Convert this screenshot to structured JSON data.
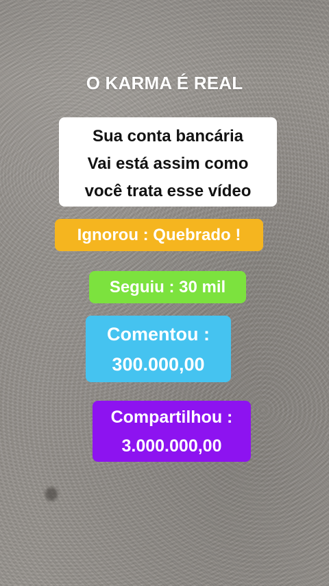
{
  "title": "O KARMA É REAL",
  "message": {
    "line1": "Sua conta bancária",
    "line2": "Vai está assim como",
    "line3": "você trata esse vídeo"
  },
  "outcomes": [
    {
      "label": "Ignorou : Quebrado !",
      "color": "#f5b51f"
    },
    {
      "label": "Seguiu : 30 mil",
      "color": "#7ce23e"
    },
    {
      "label_line1": "Comentou :",
      "label_line2": "300.000,00",
      "color": "#45c3f0"
    },
    {
      "label_line1": "Compartilhou :",
      "label_line2": "3.000.000,00",
      "color": "#8d13f0"
    }
  ]
}
